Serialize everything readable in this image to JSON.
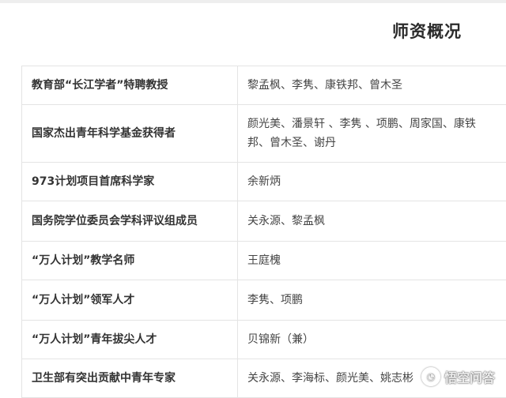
{
  "page": {
    "title": "师资概况"
  },
  "faculty_table": {
    "rows": [
      {
        "label": "教育部“长江学者”特聘教授",
        "value": "黎孟枫、李隽、康铁邦、曾木圣"
      },
      {
        "label": "国家杰出青年科学基金获得者",
        "value": "颜光美、潘景轩 、李隽 、项鹏、周家国、康铁邦、曾木圣、谢丹"
      },
      {
        "label": "973计划项目首席科学家",
        "value": "余新炳"
      },
      {
        "label": "国务院学位委员会学科评议组成员",
        "value": "关永源、黎孟枫"
      },
      {
        "label": "“万人计划”教学名师",
        "value": "王庭槐"
      },
      {
        "label": "“万人计划”领军人才",
        "value": "李隽、项鹏"
      },
      {
        "label": "“万人计划”青年拔尖人才",
        "value": "贝锦新（兼）"
      },
      {
        "label": "卫生部有突出贡献中青年专家",
        "value": "关永源、李海标、颜光美、姚志彬"
      }
    ]
  },
  "watermark": {
    "text": "悟空问答",
    "icon": "wukong-logo-icon"
  }
}
